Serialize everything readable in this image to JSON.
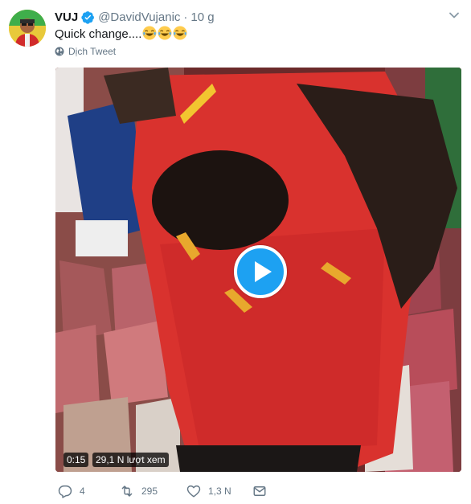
{
  "tweet": {
    "author_name": "VUJ",
    "author_handle": "@DavidVujanic",
    "separator": "·",
    "time": "10 g",
    "text": "Quick change....",
    "emojis": [
      "joy-emoji",
      "joy-emoji",
      "joy-emoji"
    ],
    "translate_label": "Dịch Tweet"
  },
  "video": {
    "duration": "0:15",
    "views": "29,1 N lượt xem",
    "play_icon": "play-icon"
  },
  "actions": {
    "replies": "4",
    "retweets": "295",
    "likes": "1,3 N"
  },
  "colors": {
    "accent": "#1da1f2",
    "verified": "#1da1f2",
    "text_secondary": "#657786",
    "text_primary": "#14171a"
  }
}
